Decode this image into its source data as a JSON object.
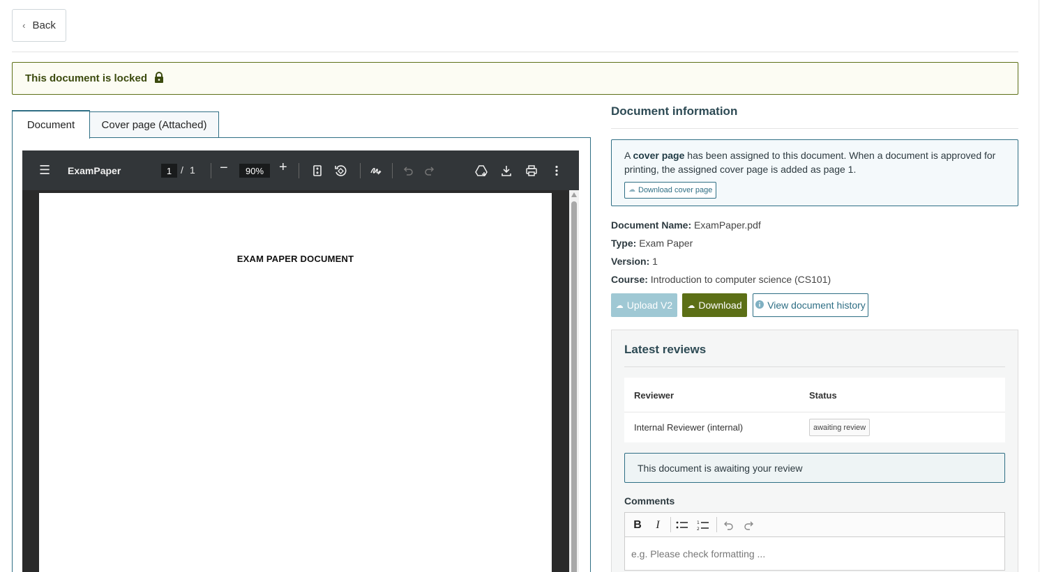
{
  "header": {
    "back_label": "Back"
  },
  "lock_banner": {
    "text": "This document is locked"
  },
  "tabs": [
    {
      "label": "Document",
      "active": true
    },
    {
      "label": "Cover page (Attached)",
      "active": false
    }
  ],
  "pdf_viewer": {
    "file_name": "ExamPaper",
    "current_page": "1",
    "page_separator": "/",
    "total_pages": "1",
    "zoom": "90%",
    "page_title": "EXAM PAPER DOCUMENT",
    "icons": [
      "menu-icon",
      "zoom-out-icon",
      "zoom-in-icon",
      "fit-page-icon",
      "rotate-icon",
      "annotate-icon",
      "undo-icon",
      "redo-icon",
      "drive-icon",
      "download-icon",
      "print-icon",
      "more-icon"
    ]
  },
  "info": {
    "title": "Document information",
    "cover_notice": {
      "prefix": "A ",
      "bold": "cover page",
      "suffix": " has been assigned to this document. When a document is approved for printing, the assigned cover page is added as page 1.",
      "download_label": "Download cover page"
    },
    "fields": {
      "name_label": "Document Name:",
      "name_value": "ExamPaper.pdf",
      "type_label": "Type:",
      "type_value": "Exam Paper",
      "version_label": "Version:",
      "version_value": "1",
      "course_label": "Course:",
      "course_value": "Introduction to computer science (CS101)"
    },
    "actions": {
      "upload_label": "Upload V2",
      "download_label": "Download",
      "history_label": "View document history"
    }
  },
  "reviews": {
    "title": "Latest reviews",
    "headers": {
      "reviewer": "Reviewer",
      "status": "Status"
    },
    "rows": [
      {
        "reviewer": "Internal Reviewer (internal)",
        "status": "awaiting review"
      }
    ],
    "awaiting_message": "This document is awaiting your review",
    "comments_label": "Comments",
    "comments_placeholder": "e.g. Please check formatting ..."
  },
  "colors": {
    "accent": "#2e6e84",
    "olive": "#5c6f16",
    "upload_disabled": "#9fc8d4"
  }
}
